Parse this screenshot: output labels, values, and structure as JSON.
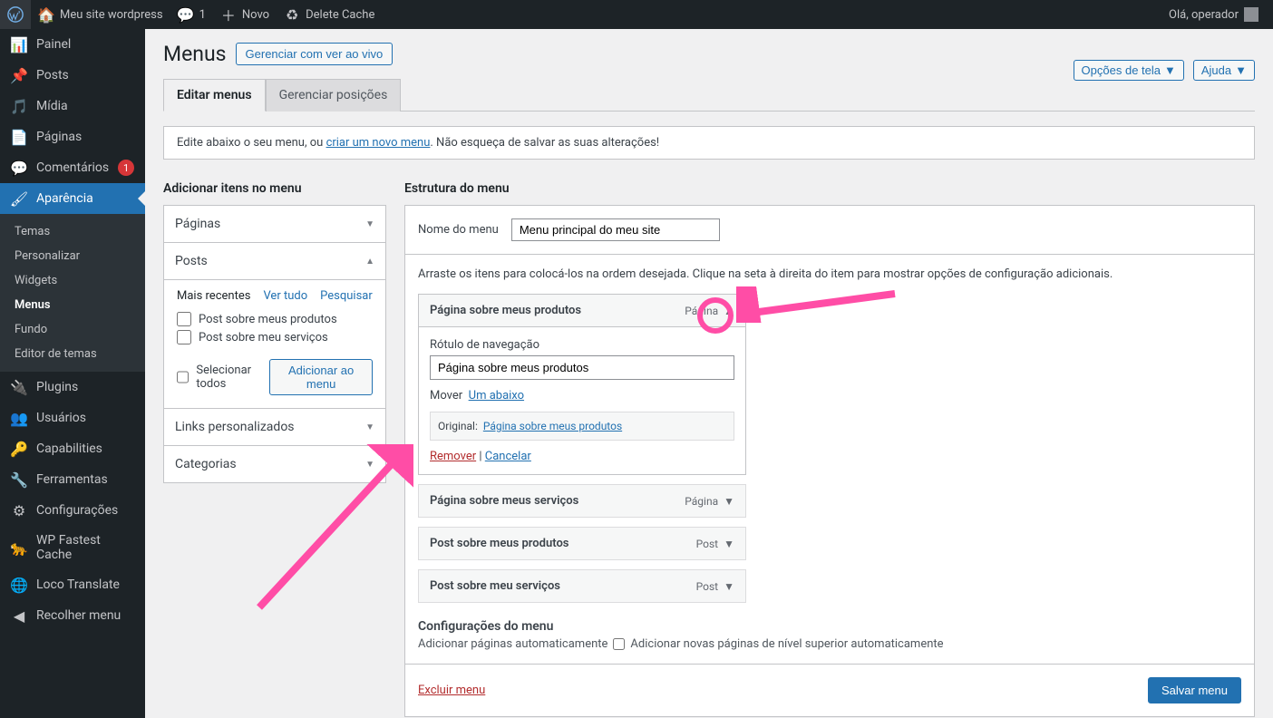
{
  "adminbar": {
    "site_name": "Meu site wordpress",
    "comments_count": "1",
    "novo": "Novo",
    "delete_cache": "Delete Cache",
    "greeting": "Olá, operador"
  },
  "sidebar": {
    "painel": "Painel",
    "posts": "Posts",
    "midia": "Mídia",
    "paginas": "Páginas",
    "comentarios": "Comentários",
    "comentarios_count": "1",
    "aparencia": "Aparência",
    "temas": "Temas",
    "personalizar": "Personalizar",
    "widgets": "Widgets",
    "menus": "Menus",
    "fundo": "Fundo",
    "editor_temas": "Editor de temas",
    "plugins": "Plugins",
    "usuarios": "Usuários",
    "capabilities": "Capabilities",
    "ferramentas": "Ferramentas",
    "configuracoes": "Configurações",
    "wp_fastest": "WP Fastest Cache",
    "loco": "Loco Translate",
    "recolher": "Recolher menu"
  },
  "page": {
    "title": "Menus",
    "manage_live": "Gerenciar com ver ao vivo",
    "screen_options": "Opções de tela",
    "help": "Ajuda",
    "tab_edit": "Editar menus",
    "tab_positions": "Gerenciar posições",
    "notice_pre": "Edite abaixo o seu menu, ou ",
    "notice_link": "criar um novo menu",
    "notice_post": ". Não esqueça de salvar as suas alterações!"
  },
  "left": {
    "title": "Adicionar itens no menu",
    "acc_pages": "Páginas",
    "acc_posts": "Posts",
    "acc_links": "Links personalizados",
    "acc_categories": "Categorias",
    "mt_recent": "Mais recentes",
    "mt_all": "Ver tudo",
    "mt_search": "Pesquisar",
    "post1": "Post sobre meus produtos",
    "post2": "Post sobre meu serviços",
    "select_all": "Selecionar todos",
    "add_to_menu": "Adicionar ao menu"
  },
  "right": {
    "structure_title": "Estrutura do menu",
    "menu_name_label": "Nome do menu",
    "menu_name_value": "Menu principal do meu site",
    "drag_hint": "Arraste os itens para colocá-los na ordem desejada. Clique na seta à direita do item para mostrar opções de configuração adicionais.",
    "type_page": "Página",
    "type_post": "Post",
    "item1_title": "Página sobre meus produtos",
    "nav_label": "Rótulo de navegação",
    "nav_value": "Página sobre meus produtos",
    "move_label": "Mover",
    "move_down": "Um abaixo",
    "original_label": "Original:",
    "original_link": "Página sobre meus produtos",
    "remove": "Remover",
    "cancel": "Cancelar",
    "item2_title": "Página sobre meus serviços",
    "item3_title": "Post sobre meus produtos",
    "item4_title": "Post sobre meu serviços",
    "settings_title": "Configurações do menu",
    "auto_add_label": "Adicionar páginas automaticamente",
    "auto_add_text": "Adicionar novas páginas de nível superior automaticamente",
    "delete_menu": "Excluir menu",
    "save_menu": "Salvar menu"
  }
}
